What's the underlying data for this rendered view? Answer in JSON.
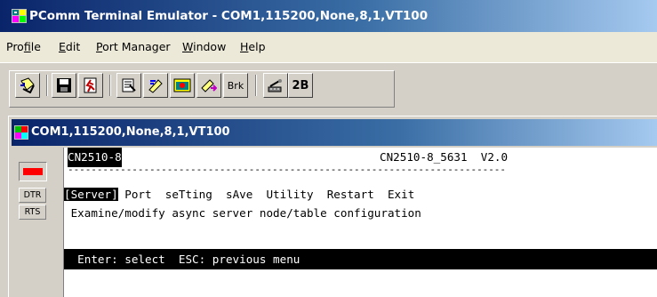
{
  "app": {
    "title": "PComm Terminal Emulator - COM1,115200,None,8,1,VT100"
  },
  "menu": {
    "items": [
      {
        "pre": "Pro",
        "accel": "f",
        "post": "ile"
      },
      {
        "pre": "",
        "accel": "E",
        "post": "dit"
      },
      {
        "pre": "",
        "accel": "P",
        "post": "ort Manager"
      },
      {
        "pre": "",
        "accel": "W",
        "post": "indow"
      },
      {
        "pre": "",
        "accel": "H",
        "post": "elp"
      }
    ]
  },
  "toolbar": {
    "brk_label": "Brk",
    "twob_label": "2B"
  },
  "child": {
    "title": "COM1,115200,None,8,1,VT100"
  },
  "signals": {
    "dtr": "DTR",
    "rts": "RTS"
  },
  "terminal": {
    "device_name": "CN2510-8",
    "device_info": "CN2510-8_5631  V2.0",
    "rule": "---------------------------------------------------------------------------",
    "selected_menu": "[Server]",
    "menu_rest": " Port  seTting  sAve  Utility  Restart  Exit",
    "description": " Examine/modify async server node/table configuration",
    "status": "  Enter: select  ESC: previous menu"
  }
}
